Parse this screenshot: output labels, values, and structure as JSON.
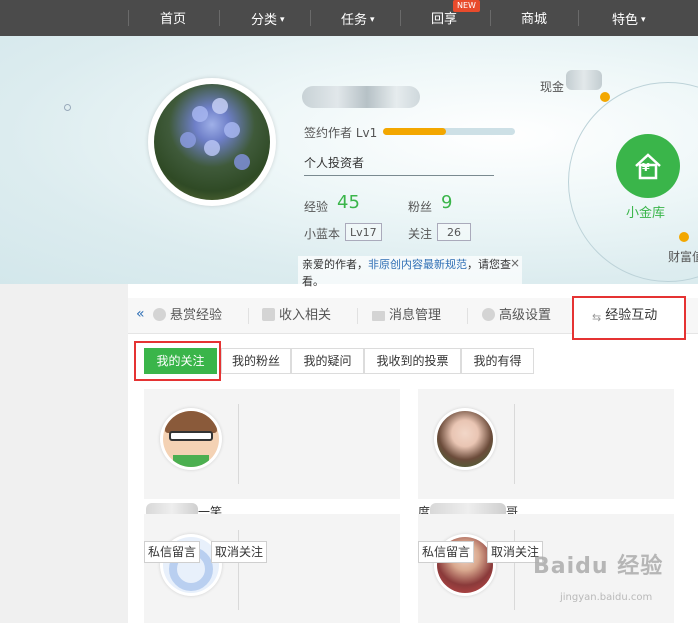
{
  "nav": {
    "items": [
      {
        "label": "首页",
        "dropdown": false
      },
      {
        "label": "分类",
        "dropdown": true
      },
      {
        "label": "任务",
        "dropdown": true
      },
      {
        "label": "回享",
        "dropdown": false
      },
      {
        "label": "商城",
        "dropdown": false
      },
      {
        "label": "特色",
        "dropdown": true
      }
    ],
    "new_badge": "NEW"
  },
  "profile": {
    "level_label": "签约作者 Lv1",
    "level_progress": 0.48,
    "bio": "个人投资者",
    "exp_label": "经验",
    "exp_value": "45",
    "fans_label": "粉丝",
    "fans_value": "9",
    "blue_book_label": "小蓝本",
    "blue_book_level": "Lv17",
    "follow_label": "关注",
    "follow_value": "26"
  },
  "notice": {
    "prefix": "亲爱的作者，",
    "link": "非原创内容最新规范",
    "suffix": "，请您查看。",
    "close": "×"
  },
  "wallet": {
    "cash_label": "现金",
    "vault_label": "小金库",
    "vault_icon": "¥",
    "wealth_label": "财富值"
  },
  "tabs": {
    "collapse": "«",
    "items": [
      {
        "label": "悬赏经验",
        "icon": "coin-icon"
      },
      {
        "label": "收入相关",
        "icon": "yen-icon"
      },
      {
        "label": "消息管理",
        "icon": "mail-icon"
      },
      {
        "label": "高级设置",
        "icon": "gear-icon"
      },
      {
        "label": "经验互动",
        "icon": "swap-icon"
      }
    ],
    "active_index": 4
  },
  "subtabs": {
    "items": [
      "我的关注",
      "我的粉丝",
      "我的疑问",
      "我收到的投票",
      "我的有得"
    ],
    "active_index": 0
  },
  "follows": {
    "cards": [
      {
        "name_tail": "一笑"
      },
      {
        "name_head": "度",
        "name_tail": "哥"
      }
    ],
    "message_button": "私信留言",
    "unfollow_button": "取消关注"
  },
  "watermark": {
    "brand": "Baidu 经验",
    "url": "jingyan.baidu.com"
  },
  "colors": {
    "accent_green": "#3ab54a",
    "highlight_red": "#e53333",
    "progress_orange": "#f3a700",
    "nav_bg": "#4b4b4b",
    "link_blue": "#2f6fb5"
  }
}
